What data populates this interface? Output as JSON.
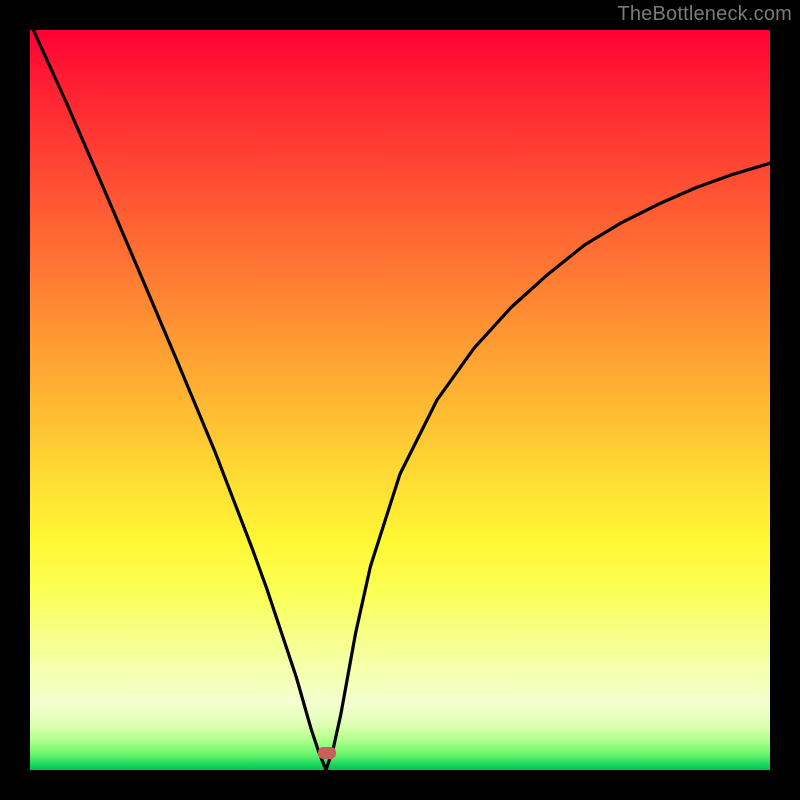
{
  "watermark": "TheBottleneck.com",
  "marker": {
    "x_frac": 0.402,
    "y_frac": 0.977
  },
  "chart_data": {
    "type": "line",
    "title": "",
    "xlabel": "",
    "ylabel": "",
    "xlim": [
      0,
      1
    ],
    "ylim": [
      0,
      1
    ],
    "series": [
      {
        "name": "bottleneck-curve",
        "x": [
          0.0,
          0.05,
          0.1,
          0.15,
          0.2,
          0.25,
          0.3,
          0.32,
          0.34,
          0.36,
          0.38,
          0.39,
          0.4,
          0.41,
          0.42,
          0.43,
          0.44,
          0.46,
          0.5,
          0.55,
          0.6,
          0.65,
          0.7,
          0.75,
          0.8,
          0.85,
          0.9,
          0.95,
          1.0
        ],
        "y": [
          1.01,
          0.9,
          0.785,
          0.668,
          0.55,
          0.43,
          0.3,
          0.245,
          0.185,
          0.125,
          0.055,
          0.025,
          0.0,
          0.03,
          0.075,
          0.13,
          0.185,
          0.275,
          0.4,
          0.5,
          0.57,
          0.625,
          0.67,
          0.71,
          0.74,
          0.765,
          0.787,
          0.805,
          0.82
        ]
      }
    ],
    "annotations": [
      {
        "text": "marker",
        "x": 0.402,
        "y": 0.023
      }
    ],
    "gradient_stops": [
      {
        "pos": 0.0,
        "color": "#ff0033"
      },
      {
        "pos": 0.5,
        "color": "#ffc033"
      },
      {
        "pos": 0.78,
        "color": "#f8ff5a"
      },
      {
        "pos": 0.92,
        "color": "#f3ffd0"
      },
      {
        "pos": 1.0,
        "color": "#03c44e"
      }
    ]
  }
}
